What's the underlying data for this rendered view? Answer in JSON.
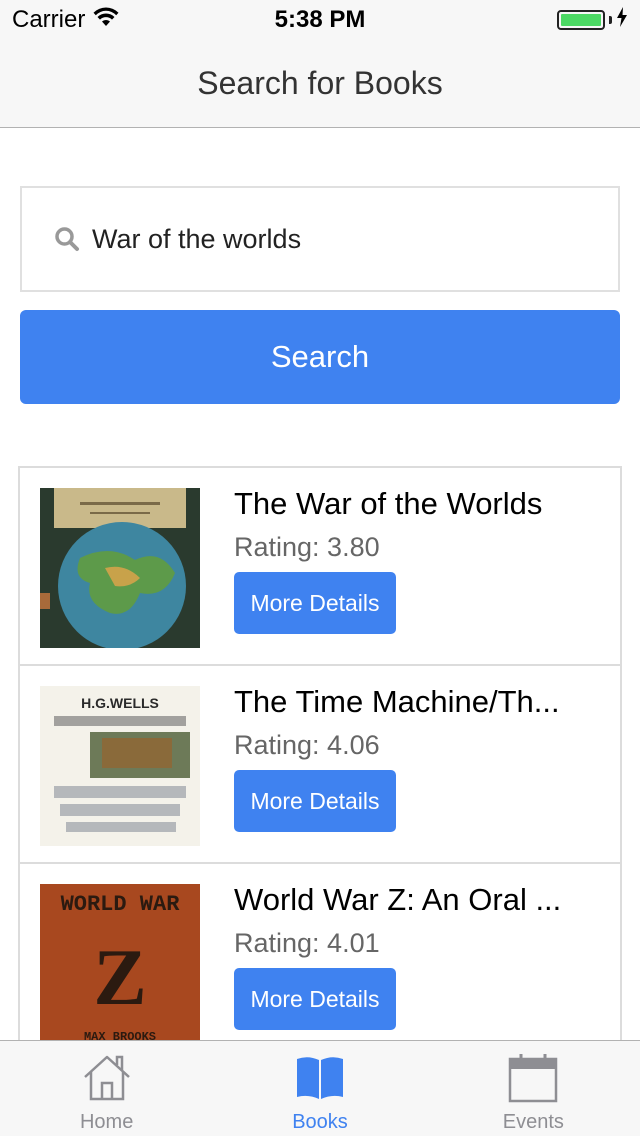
{
  "status_bar": {
    "carrier": "Carrier",
    "time": "5:38 PM"
  },
  "nav": {
    "title": "Search for Books"
  },
  "search": {
    "value": "War of the worlds",
    "button_label": "Search"
  },
  "results": [
    {
      "title": "The War of the Worlds",
      "rating": "Rating: 3.80",
      "details_label": "More Details"
    },
    {
      "title": "The Time Machine/Th...",
      "rating": "Rating: 4.06",
      "details_label": "More Details"
    },
    {
      "title": "World War Z: An Oral ...",
      "rating": "Rating: 4.01",
      "details_label": "More Details"
    }
  ],
  "covers": {
    "second_cover_text_top": "H.G.WELLS",
    "third_cover_text_top": "WORLD WAR",
    "third_cover_letter": "Z",
    "third_cover_author": "MAX BROOKS"
  },
  "tabs": [
    {
      "label": "Home",
      "icon": "home-icon",
      "active": false
    },
    {
      "label": "Books",
      "icon": "book-icon",
      "active": true
    },
    {
      "label": "Events",
      "icon": "calendar-icon",
      "active": false
    }
  ],
  "colors": {
    "accent": "#3f82f0",
    "battery": "#4cd964",
    "inactive_tab": "#8e8e93"
  }
}
